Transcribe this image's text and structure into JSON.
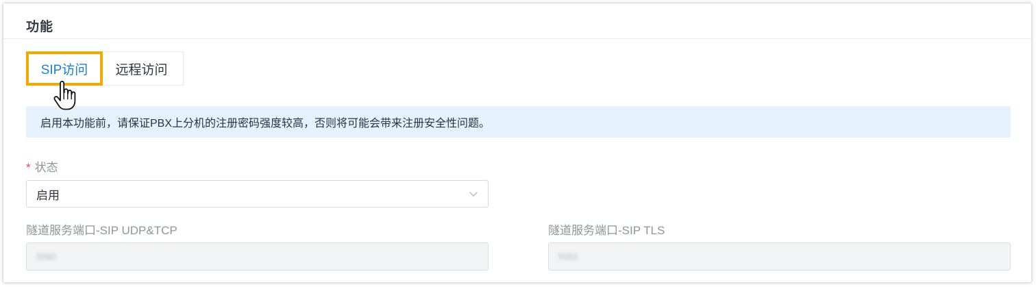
{
  "panel": {
    "title": "功能"
  },
  "tabs": [
    {
      "label": "SIP访问",
      "active": true
    },
    {
      "label": "远程访问",
      "active": false
    }
  ],
  "alert": {
    "text": "启用本功能前，请保证PBX上分机的注册密码强度较高，否则将可能会带来注册安全性问题。"
  },
  "form": {
    "status": {
      "required_mark": "*",
      "label": "状态",
      "value": "启用"
    },
    "udp_tcp_port": {
      "label": "隧道服务端口-SIP UDP&TCP",
      "value": "5060",
      "disabled": true
    },
    "tls_port": {
      "label": "隧道服务端口-SIP TLS",
      "value": "5061",
      "disabled": true
    }
  },
  "colors": {
    "highlight_border": "#f5a800",
    "active_tab_text": "#1a80d6",
    "alert_background": "#e6f2fb",
    "required_mark": "#e5484d"
  },
  "icons": {
    "cursor": "hand-pointer-icon",
    "select_arrow": "chevron-down-icon"
  }
}
